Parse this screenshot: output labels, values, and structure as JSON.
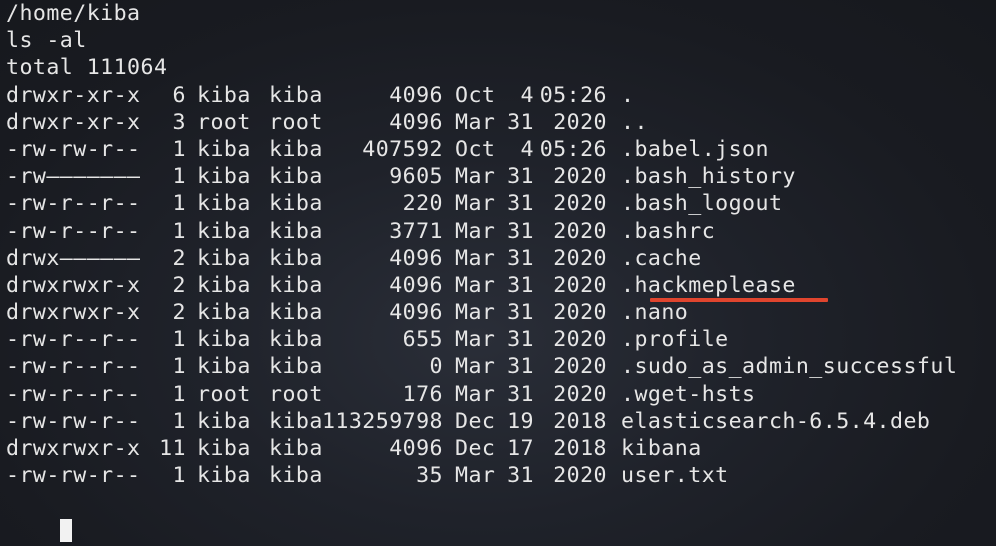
{
  "terminal": {
    "cwd_line": "/home/kiba",
    "command_line": "ls -al",
    "total_line": "total 111064",
    "entries": [
      {
        "perm": "drwxr-xr-x",
        "links": "6",
        "owner": "kiba",
        "group": "kiba",
        "size": "4096",
        "month": "Oct",
        "day": "4",
        "time": "05:26",
        "name": "."
      },
      {
        "perm": "drwxr-xr-x",
        "links": "3",
        "owner": "root",
        "group": "root",
        "size": "4096",
        "month": "Mar",
        "day": "31",
        "time": "2020",
        "name": ".."
      },
      {
        "perm": "-rw-rw-r--",
        "links": "1",
        "owner": "kiba",
        "group": "kiba",
        "size": "407592",
        "month": "Oct",
        "day": "4",
        "time": "05:26",
        "name": ".babel.json"
      },
      {
        "perm": "-rw———————",
        "links": "1",
        "owner": "kiba",
        "group": "kiba",
        "size": "9605",
        "month": "Mar",
        "day": "31",
        "time": "2020",
        "name": ".bash_history"
      },
      {
        "perm": "-rw-r--r--",
        "links": "1",
        "owner": "kiba",
        "group": "kiba",
        "size": "220",
        "month": "Mar",
        "day": "31",
        "time": "2020",
        "name": ".bash_logout"
      },
      {
        "perm": "-rw-r--r--",
        "links": "1",
        "owner": "kiba",
        "group": "kiba",
        "size": "3771",
        "month": "Mar",
        "day": "31",
        "time": "2020",
        "name": ".bashrc"
      },
      {
        "perm": "drwx——————",
        "links": "2",
        "owner": "kiba",
        "group": "kiba",
        "size": "4096",
        "month": "Mar",
        "day": "31",
        "time": "2020",
        "name": ".cache"
      },
      {
        "perm": "drwxrwxr-x",
        "links": "2",
        "owner": "kiba",
        "group": "kiba",
        "size": "4096",
        "month": "Mar",
        "day": "31",
        "time": "2020",
        "name": ".hackmeplease"
      },
      {
        "perm": "drwxrwxr-x",
        "links": "2",
        "owner": "kiba",
        "group": "kiba",
        "size": "4096",
        "month": "Mar",
        "day": "31",
        "time": "2020",
        "name": ".nano"
      },
      {
        "perm": "-rw-r--r--",
        "links": "1",
        "owner": "kiba",
        "group": "kiba",
        "size": "655",
        "month": "Mar",
        "day": "31",
        "time": "2020",
        "name": ".profile"
      },
      {
        "perm": "-rw-r--r--",
        "links": "1",
        "owner": "kiba",
        "group": "kiba",
        "size": "0",
        "month": "Mar",
        "day": "31",
        "time": "2020",
        "name": ".sudo_as_admin_successful"
      },
      {
        "perm": "-rw-r--r--",
        "links": "1",
        "owner": "root",
        "group": "root",
        "size": "176",
        "month": "Mar",
        "day": "31",
        "time": "2020",
        "name": ".wget-hsts"
      },
      {
        "perm": "-rw-rw-r--",
        "links": "1",
        "owner": "kiba",
        "group": "kiba",
        "size": "113259798",
        "month": "Dec",
        "day": "19",
        "time": "2018",
        "name": "elasticsearch-6.5.4.deb"
      },
      {
        "perm": "drwxrwxr-x",
        "links": "11",
        "owner": "kiba",
        "group": "kiba",
        "size": "4096",
        "month": "Dec",
        "day": "17",
        "time": "2018",
        "name": "kibana"
      },
      {
        "perm": "-rw-rw-r--",
        "links": "1",
        "owner": "kiba",
        "group": "kiba",
        "size": "35",
        "month": "Mar",
        "day": "31",
        "time": "2020",
        "name": "user.txt"
      }
    ]
  },
  "colors": {
    "text": "#e6e6e6",
    "background": "#1c1f26",
    "highlight_underline": "#e0452e",
    "cursor": "#f2f2f2"
  }
}
